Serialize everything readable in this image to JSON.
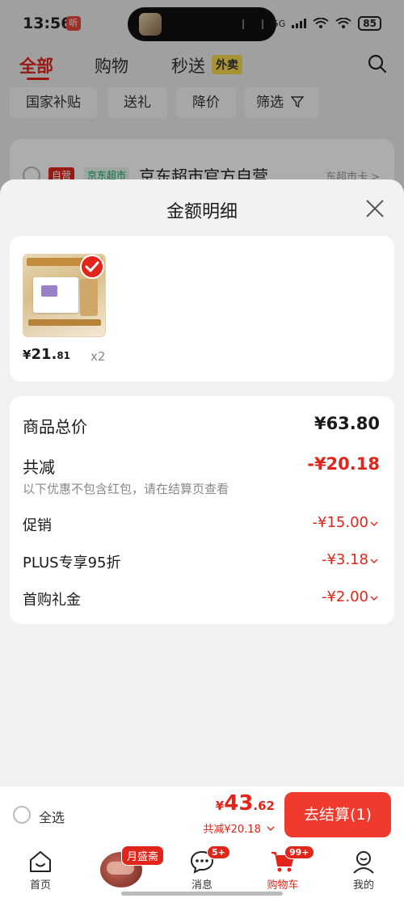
{
  "status_bar": {
    "time": "13:56",
    "app_badge": "听",
    "network": "5G",
    "battery": "85"
  },
  "top_tabs": [
    {
      "label": "全部",
      "active": true
    },
    {
      "label": "购物",
      "active": false
    },
    {
      "label": "秒送",
      "active": false
    }
  ],
  "waimai_tag": "外卖",
  "filters": [
    "国家补贴",
    "送礼",
    "降价",
    "筛选"
  ],
  "shop": {
    "self_tag": "自营",
    "market_tag": "京东超市",
    "name": "京东超市官方自营",
    "right_text": "东超市卡 >"
  },
  "sheet": {
    "title": "金额明细",
    "product": {
      "price_symbol": "¥",
      "price_int": "21.",
      "price_dec": "81",
      "qty": "x2"
    },
    "detail": {
      "total_label": "商品总价",
      "total_value": "¥63.80",
      "reduce_label": "共减",
      "reduce_value": "-¥20.18",
      "note": "以下优惠不包含红包，请在结算页查看",
      "items": [
        {
          "label": "促销",
          "value": "-¥15.00"
        },
        {
          "label": "PLUS专享95折",
          "value": "-¥3.18"
        },
        {
          "label": "首购礼金",
          "value": "-¥2.00"
        }
      ]
    }
  },
  "checkout": {
    "select_all": "全选",
    "price_symbol": "¥",
    "price_int": "43",
    "price_dec": ".62",
    "save_text": "共减¥20.18",
    "button": "去结算(1)"
  },
  "tab_bar": {
    "items": [
      {
        "label": "首页",
        "badge": ""
      },
      {
        "label": "消息",
        "badge": "5+"
      },
      {
        "label": "购物车",
        "badge": "99+"
      },
      {
        "label": "我的",
        "badge": ""
      }
    ],
    "promo_label": "月盛斋"
  },
  "colors": {
    "accent": "#e1251b",
    "checkout_button": "#f03a2e"
  }
}
